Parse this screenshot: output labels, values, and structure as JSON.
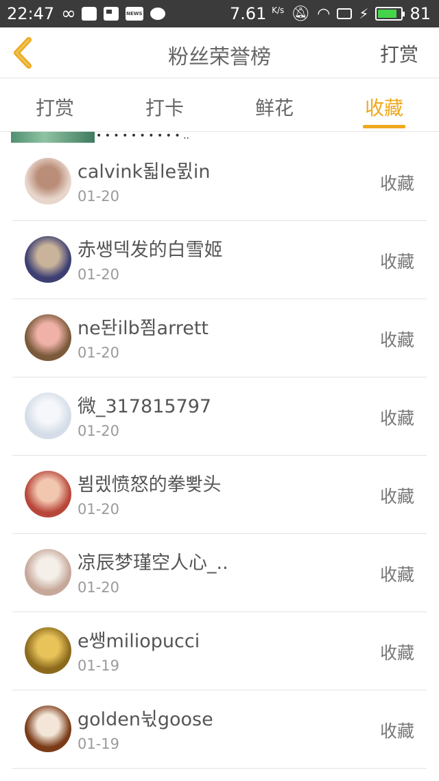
{
  "status_bar": {
    "time": "22:47",
    "speed": "7.61",
    "speed_unit": "K/s",
    "battery": "81",
    "news_label": "NEWS"
  },
  "nav": {
    "title": "粉丝荣誉榜",
    "action": "打赏",
    "back_icon": "chevron-left-icon"
  },
  "tabs": [
    {
      "label": "打赏",
      "active": false
    },
    {
      "label": "打卡",
      "active": false
    },
    {
      "label": "鲜花",
      "active": false
    },
    {
      "label": "收藏",
      "active": true
    }
  ],
  "colors": {
    "accent": "#f0a81c",
    "status_bar_bg": "#3b3b3b",
    "text": "#555555",
    "muted": "#9a9a9a"
  },
  "list": [
    {
      "name": "calvink됣le뮔in",
      "date": "01-20",
      "action": "收藏",
      "avatar": {
        "bg": "#e8d6cc",
        "fg": "#b98d78"
      }
    },
    {
      "name": "赤쌩덱发的白雪姬",
      "date": "01-20",
      "action": "收藏",
      "avatar": {
        "bg": "#3d3f73",
        "fg": "#c9b39a"
      }
    },
    {
      "name": "ne돤ilb쬠arrett",
      "date": "01-20",
      "action": "收藏",
      "avatar": {
        "bg": "#7a5a3a",
        "fg": "#f0b2a8"
      }
    },
    {
      "name": "微_317815797",
      "date": "01-20",
      "action": "收藏",
      "avatar": {
        "bg": "#d5dde8",
        "fg": "#f5f7fa"
      }
    },
    {
      "name": "뵘렜愤怒的拳뽲头",
      "date": "01-20",
      "action": "收藏",
      "avatar": {
        "bg": "#b8473b",
        "fg": "#f2c7b0"
      }
    },
    {
      "name": "凉辰梦瑾空人心_..",
      "date": "01-20",
      "action": "收藏",
      "avatar": {
        "bg": "#c6a89a",
        "fg": "#f4efe8"
      }
    },
    {
      "name": "e쌩miliopucci",
      "date": "01-19",
      "action": "收藏",
      "avatar": {
        "bg": "#8c6a1c",
        "fg": "#e8c35a"
      }
    },
    {
      "name": "golden뉛goose",
      "date": "01-19",
      "action": "收藏",
      "avatar": {
        "bg": "#7a3b18",
        "fg": "#f3e6d8"
      }
    }
  ]
}
